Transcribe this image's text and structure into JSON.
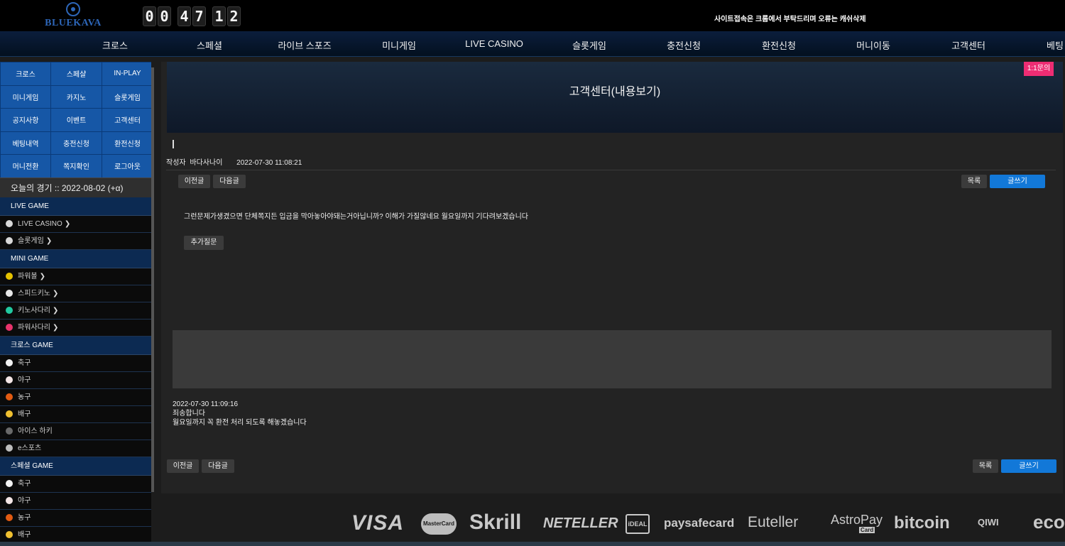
{
  "header": {
    "logo_text": "BLUEKAVA",
    "clock": [
      "0",
      "0",
      "4",
      "7",
      "1",
      "2"
    ],
    "notice": "사이트접속은 크롬에서 부탁드리며 오류는 캐쉬삭제"
  },
  "main_nav": [
    "크로스",
    "스페셜",
    "라이브 스포즈",
    "미니게임",
    "LIVE CASINO",
    "슬롯게임",
    "충전신청",
    "환전신청",
    "머니이동",
    "고객센터",
    "베팅"
  ],
  "sidebar": {
    "quick_buttons": [
      "크로스",
      "스페샬",
      "IN-PLAY",
      "미니게임",
      "카지노",
      "슬롯게임",
      "공지사항",
      "이벤트",
      "고객센터",
      "베팅내역",
      "충전신청",
      "환전신청",
      "머니전환",
      "쪽지확인",
      "로그아웃"
    ],
    "today_games": "오늘의 경기 :: 2022-08-02 (+α)",
    "sections": [
      {
        "title": "LIVE GAME",
        "items": [
          {
            "label": "LIVE CASINO",
            "icon": "dealer-icon",
            "color": "#d9d9d9",
            "chevron": true
          },
          {
            "label": "슬롯게임",
            "icon": "dealer-icon",
            "color": "#d9d9d9",
            "chevron": true
          }
        ]
      },
      {
        "title": "MINI GAME",
        "items": [
          {
            "label": "파워볼",
            "icon": "powerball-icon",
            "color": "#e6c200",
            "chevron": true
          },
          {
            "label": "스피드키노",
            "icon": "speedkeno-icon",
            "color": "#e8e8e8",
            "chevron": true
          },
          {
            "label": "키노사다리",
            "icon": "keno-ladder-icon",
            "color": "#21c9a0",
            "chevron": true
          },
          {
            "label": "파워사다리",
            "icon": "power-ladder-icon",
            "color": "#e8336b",
            "chevron": true
          }
        ]
      },
      {
        "title": "크로스 GAME",
        "items": [
          {
            "label": "축구",
            "icon": "soccer-icon",
            "color": "#f2f2f2",
            "chevron": false
          },
          {
            "label": "야구",
            "icon": "baseball-icon",
            "color": "#f4e6e6",
            "chevron": false
          },
          {
            "label": "농구",
            "icon": "basketball-icon",
            "color": "#e35b12",
            "chevron": false
          },
          {
            "label": "배구",
            "icon": "volleyball-icon",
            "color": "#f0c030",
            "chevron": false
          },
          {
            "label": "아이스 하키",
            "icon": "hockey-icon",
            "color": "#6a6a6a",
            "chevron": false
          },
          {
            "label": "e스포츠",
            "icon": "esports-icon",
            "color": "#bdbdbd",
            "chevron": false
          }
        ]
      },
      {
        "title": "스페셜 GAME",
        "items": [
          {
            "label": "축구",
            "icon": "soccer-icon",
            "color": "#f2f2f2",
            "chevron": false
          },
          {
            "label": "야구",
            "icon": "baseball-icon",
            "color": "#f4e6e6",
            "chevron": false
          },
          {
            "label": "농구",
            "icon": "basketball-icon",
            "color": "#e35b12",
            "chevron": false
          },
          {
            "label": "배구",
            "icon": "volleyball-icon",
            "color": "#f0c030",
            "chevron": false
          }
        ]
      }
    ]
  },
  "content": {
    "title": "고객센터(내용보기)",
    "badge": "1:1문의",
    "author_label": "작성자",
    "author": "바다사나이",
    "date": "2022-07-30 11:08:21",
    "prev_label": "이전글",
    "next_label": "다음글",
    "list_label": "목록",
    "write_label": "글쓰기",
    "question": "그런문제가생겼으면 단체쪽지든 입금을 막아놓아야돼는거아닙니까? 이해가 가질않네요 월요일까지 기다려보겠습니다",
    "followup_label": "추가질문",
    "answer_date": "2022-07-30 11:09:16",
    "answer_line1": "죄송합니다",
    "answer_line2": "월요일까지 꼭 환전 처리 되도록 해놓겠습니다"
  },
  "payments": [
    "VISA",
    "MasterCard",
    "Skrill",
    "NETELLER",
    "iDEAL",
    "paysafecard",
    "Euteller",
    "AstroPay",
    "Card",
    "bitcoin",
    "QIWI",
    "eco"
  ]
}
